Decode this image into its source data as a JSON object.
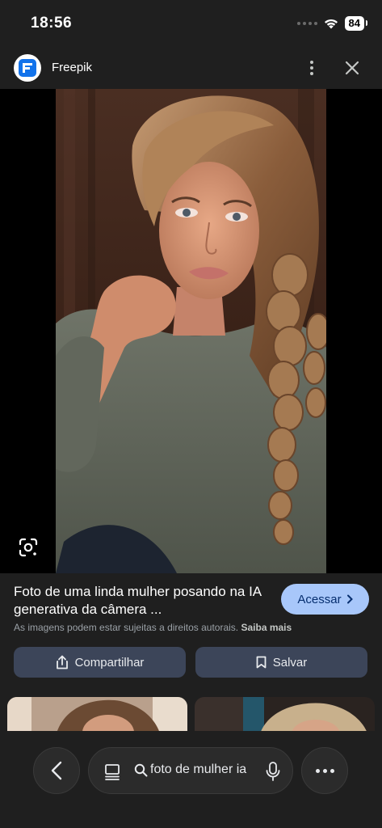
{
  "status": {
    "time": "18:56",
    "battery": "84"
  },
  "header": {
    "site_name": "Freepik",
    "logo_icon": "freepik-logo",
    "menu_icon": "kebab-menu-icon",
    "close_icon": "close-icon"
  },
  "result": {
    "title": "Foto de uma linda mulher posando na IA generativa da câmera ...",
    "visit_label": "Acessar",
    "copyright_text": "As imagens podem estar sujeitas a direitos autorais.",
    "learn_more": "Saiba mais",
    "share_label": "Compartilhar",
    "save_label": "Salvar"
  },
  "bottom_bar": {
    "query": "foto de mulher ia"
  },
  "colors": {
    "background": "#1f1f1f",
    "accent": "#a8c7fa",
    "action_button": "#3c4559"
  }
}
